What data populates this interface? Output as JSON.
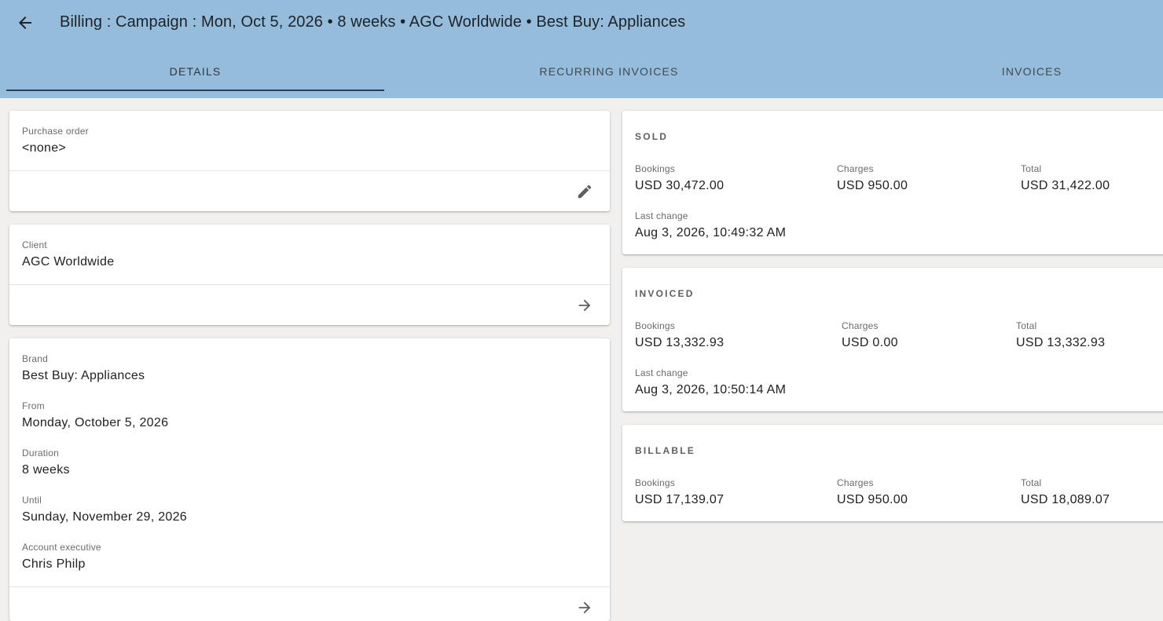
{
  "header": {
    "title": "Billing : Campaign : Mon, Oct 5, 2026 • 8 weeks • AGC Worldwide • Best Buy: Appliances",
    "back_icon": "arrow-left-icon"
  },
  "tabs": [
    {
      "label": "DETAILS",
      "active": true
    },
    {
      "label": "RECURRING INVOICES",
      "active": false
    },
    {
      "label": "INVOICES",
      "active": false
    }
  ],
  "purchase_order": {
    "label": "Purchase order",
    "value": "<none>",
    "action_icon": "pencil-icon"
  },
  "client": {
    "label": "Client",
    "value": "AGC Worldwide",
    "action_icon": "arrow-right-icon"
  },
  "campaign": {
    "brand": {
      "label": "Brand",
      "value": "Best Buy: Appliances"
    },
    "from": {
      "label": "From",
      "value": "Monday, October 5, 2026"
    },
    "duration": {
      "label": "Duration",
      "value": "8 weeks"
    },
    "until": {
      "label": "Until",
      "value": "Sunday, November 29, 2026"
    },
    "account_executive": {
      "label": "Account executive",
      "value": "Chris Philp"
    },
    "action_icon": "arrow-right-icon"
  },
  "sold": {
    "title": "SOLD",
    "bookings": {
      "label": "Bookings",
      "value": "USD 30,472.00"
    },
    "charges": {
      "label": "Charges",
      "value": "USD 950.00"
    },
    "total": {
      "label": "Total",
      "value": "USD 31,422.00"
    },
    "last_change": {
      "label": "Last change",
      "value": "Aug 3, 2026, 10:49:32 AM"
    }
  },
  "invoiced": {
    "title": "INVOICED",
    "bookings": {
      "label": "Bookings",
      "value": "USD 13,332.93"
    },
    "charges": {
      "label": "Charges",
      "value": "USD 0.00"
    },
    "total": {
      "label": "Total",
      "value": "USD 13,332.93"
    },
    "last_change": {
      "label": "Last change",
      "value": "Aug 3, 2026, 10:50:14 AM"
    }
  },
  "billable": {
    "title": "BILLABLE",
    "bookings": {
      "label": "Bookings",
      "value": "USD 17,139.07"
    },
    "charges": {
      "label": "Charges",
      "value": "USD 950.00"
    },
    "total": {
      "label": "Total",
      "value": "USD 18,089.07"
    }
  },
  "colors": {
    "appbar": "#96bcdb",
    "background": "#f1f0ee",
    "tab_indicator": "#2c3e4d"
  }
}
